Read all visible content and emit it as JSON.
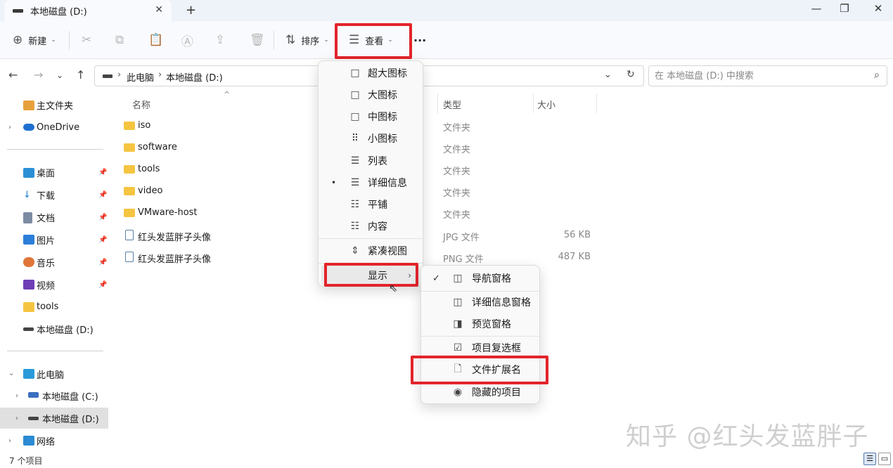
{
  "tab": {
    "title": "本地磁盘 (D:)",
    "close": "✕",
    "new_tab": "+"
  },
  "window": {
    "minimize": "—",
    "maximize": "❐",
    "close": "✕"
  },
  "toolbar": {
    "new_label": "新建",
    "sort_label": "排序",
    "view_label": "查看",
    "more_label": "···"
  },
  "address": {
    "crumbs": [
      "此电脑",
      "本地磁盘 (D:)"
    ],
    "search_placeholder": "在 本地磁盘 (D:) 中搜索"
  },
  "sidebar": {
    "items": [
      {
        "label": "主文件夹",
        "icon": "home-icon"
      },
      {
        "label": "OneDrive",
        "icon": "cloud-icon"
      },
      {
        "label": "桌面",
        "icon": "desktop-icon"
      },
      {
        "label": "下载",
        "icon": "download-icon"
      },
      {
        "label": "文档",
        "icon": "document-icon"
      },
      {
        "label": "图片",
        "icon": "pictures-icon"
      },
      {
        "label": "音乐",
        "icon": "music-icon"
      },
      {
        "label": "视频",
        "icon": "video-icon"
      },
      {
        "label": "tools",
        "icon": "folder-icon"
      },
      {
        "label": "本地磁盘 (D:)",
        "icon": "drive-icon"
      },
      {
        "label": "此电脑",
        "icon": "pc-icon"
      },
      {
        "label": "本地磁盘 (C:)",
        "icon": "drive-icon"
      },
      {
        "label": "本地磁盘 (D:)",
        "icon": "drive-icon"
      },
      {
        "label": "网络",
        "icon": "network-icon"
      }
    ]
  },
  "columns": {
    "name": "名称",
    "type": "类型",
    "size": "大小"
  },
  "files": [
    {
      "name": "iso",
      "type": "文件夹",
      "size": ""
    },
    {
      "name": "software",
      "type": "文件夹",
      "size": ""
    },
    {
      "name": "tools",
      "type": "文件夹",
      "size": ""
    },
    {
      "name": "video",
      "type": "文件夹",
      "size": ""
    },
    {
      "name": "VMware-host",
      "type": "文件夹",
      "size": ""
    },
    {
      "name": "红头发蓝胖子头像",
      "type": "JPG 文件",
      "size": "56 KB"
    },
    {
      "name": "红头发蓝胖子头像",
      "type": "PNG 文件",
      "size": "487 KB"
    }
  ],
  "view_menu": {
    "items": [
      {
        "label": "超大图标",
        "icon": "□"
      },
      {
        "label": "大图标",
        "icon": "□"
      },
      {
        "label": "中图标",
        "icon": "□"
      },
      {
        "label": "小图标",
        "icon": "⠿"
      },
      {
        "label": "列表",
        "icon": "☰"
      },
      {
        "label": "详细信息",
        "icon": "☰"
      },
      {
        "label": "平铺",
        "icon": "☷"
      },
      {
        "label": "内容",
        "icon": "☷"
      },
      {
        "label": "紧凑视图",
        "icon": "⇕"
      },
      {
        "label": "显示",
        "icon": ""
      }
    ],
    "selected_bullet": "•",
    "arrow": "›"
  },
  "show_submenu": {
    "items": [
      {
        "label": "导航窗格",
        "checked": "✓"
      },
      {
        "label": "详细信息窗格",
        "checked": ""
      },
      {
        "label": "预览窗格",
        "checked": ""
      },
      {
        "label": "项目复选框",
        "checked": ""
      },
      {
        "label": "文件扩展名",
        "checked": ""
      },
      {
        "label": "隐藏的项目",
        "checked": ""
      }
    ]
  },
  "status": {
    "count": "7 个项目"
  },
  "watermark": "知乎 @红头发蓝胖子",
  "colors": {
    "highlight": "#e3242b",
    "folder": "#f5c542",
    "accent": "#0067c0"
  }
}
